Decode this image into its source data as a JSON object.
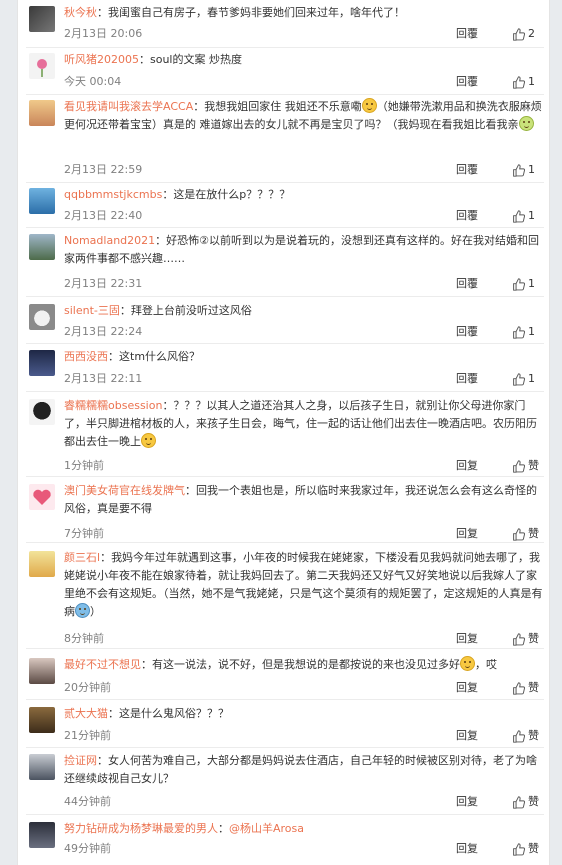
{
  "comments": [
    {
      "user": "秋今秋",
      "text": "我闺蜜自己有房子，春节爹妈非要她们回来过年，啥年代了！",
      "time": "2月13日 20:06",
      "reply": "回覆",
      "likes": "2",
      "avatar": "avatar-dark"
    },
    {
      "user": "听风猪202005",
      "text": "soul的文案 炒热度",
      "time": "今天 00:04",
      "reply": "回覆",
      "likes": "1",
      "avatar": "avatar-flower"
    },
    {
      "user": "看见我请叫我滚去学ACCA",
      "text_a": "我想我姐回家住 我姐还不乐意嘞",
      "text_b": "（她嫌带洗漱用品和换洗衣服麻烦 更何况还带着宝宝）真是的 难道嫁出去的女儿就不再是宝贝了吗？（我妈现在看我姐比看我亲",
      "text_c": "",
      "time": "2月13日 22:59",
      "reply": "回覆",
      "likes": "1",
      "avatar": "avatar-girl"
    },
    {
      "user": "qqbbmmstjkcmbs",
      "text": "这是在放什么p？？？？",
      "time": "2月13日 22:40",
      "reply": "回覆",
      "likes": "1",
      "avatar": "avatar-sea"
    },
    {
      "user": "Nomadland2021",
      "text": "好恐怖②以前听到以为是说着玩的，没想到还真有这样的。好在我对结婚和回家两件事都不感兴趣……",
      "time": "2月13日 22:31",
      "reply": "回覆",
      "likes": "1",
      "avatar": "avatar-landscape"
    },
    {
      "user": "silent-三固",
      "text": "拜登上台前没听过这风俗",
      "time": "2月13日 22:24",
      "reply": "回覆",
      "likes": "1",
      "avatar": "avatar-cat"
    },
    {
      "user": "西西没西",
      "text": "这tm什么风俗？",
      "time": "2月13日 22:11",
      "reply": "回覆",
      "likes": "1",
      "avatar": "avatar-night"
    },
    {
      "user": "睿糯糯糯obsession",
      "text_a": "？？？以其人之道还治其人之身，以后孩子生日，就别让你父母进你家门了，半只脚进棺材板的人，来孩子生日会，晦气，住一起的话让他们出去住一晚酒店吧。农历阳历都出去住一晚上",
      "text_b": "",
      "time": "1分钟前",
      "reply": "回复",
      "likes": "赞",
      "avatar": "avatar-mask"
    },
    {
      "user": "澳门美女荷官在线发牌气",
      "text": "回我一个表姐也是，所以临时来我家过年，我还说怎么会有这么奇怪的风俗，真是要不得",
      "time": "7分钟前",
      "reply": "回复",
      "likes": "赞",
      "avatar": "avatar-heart"
    },
    {
      "user": "颜三石l",
      "text_a": "我妈今年过年就遇到这事，小年夜的时候我在姥姥家，下楼没看见我妈就问她去哪了，我姥姥说小年夜不能在娘家待着，就让我妈回去了。第二天我妈还又好气又好笑地说以后我嫁人了家里绝不会有这规矩。（当然，她不是气我姥姥，只是气这个莫须有的规矩罢了，定这规矩的人真是有病",
      "text_b": "）",
      "time": "8分钟前",
      "reply": "回复",
      "likes": "赞",
      "avatar": "avatar-anime"
    },
    {
      "user": "最好不过不想见",
      "text_a": "有这一说法，说不好，但是我想说的是都按说的来也没见过多好",
      "text_b": "，哎",
      "time": "20分钟前",
      "reply": "回复",
      "likes": "赞",
      "avatar": "avatar-woman"
    },
    {
      "user": "贰大大猫",
      "text": "这是什么鬼风俗？？？",
      "time": "21分钟前",
      "reply": "回复",
      "likes": "赞",
      "avatar": "avatar-cat2"
    },
    {
      "user": "捡证网",
      "text": "女人何苦为难自己，大部分都是妈妈说去住酒店，自己年轻的时候被区别对待，老了为啥还继续歧视自己女儿？",
      "time": "44分钟前",
      "reply": "回复",
      "likes": "赞",
      "avatar": "avatar-man"
    },
    {
      "user": "努力钻研成为杨梦琳最爱的男人",
      "text": "@杨山羊Arosa",
      "time": "49分钟前",
      "reply": "回复",
      "likes": "赞",
      "avatar": "avatar-dark2"
    }
  ],
  "colors": {
    "username": "#eb7350",
    "text": "#333333",
    "meta": "#808080"
  }
}
